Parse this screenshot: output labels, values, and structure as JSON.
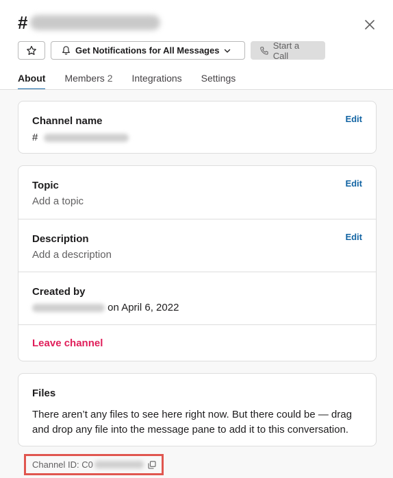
{
  "header": {
    "hash": "#",
    "close_label": "×"
  },
  "actions": {
    "notifications_label": "Get Notifications for All Messages",
    "call_label": "Start a Call"
  },
  "tabs": [
    {
      "label": "About",
      "count": ""
    },
    {
      "label": "Members",
      "count": "2"
    },
    {
      "label": "Integrations",
      "count": ""
    },
    {
      "label": "Settings",
      "count": ""
    }
  ],
  "about": {
    "channel_name_label": "Channel name",
    "channel_name_hash": "#",
    "edit_label": "Edit",
    "topic_label": "Topic",
    "topic_value": "Add a topic",
    "description_label": "Description",
    "description_value": "Add a description",
    "created_by_label": "Created by",
    "created_on": "on April 6, 2022",
    "leave_label": "Leave channel"
  },
  "files": {
    "label": "Files",
    "empty_text": "There aren’t any files to see here right now. But there could be — drag and drop any file into the message pane to add it to this conversation."
  },
  "footer": {
    "channel_id_prefix": "Channel ID: C0"
  },
  "colors": {
    "accent": "#1264a3",
    "danger": "#e01e5a",
    "highlight_box": "#e0564f"
  }
}
